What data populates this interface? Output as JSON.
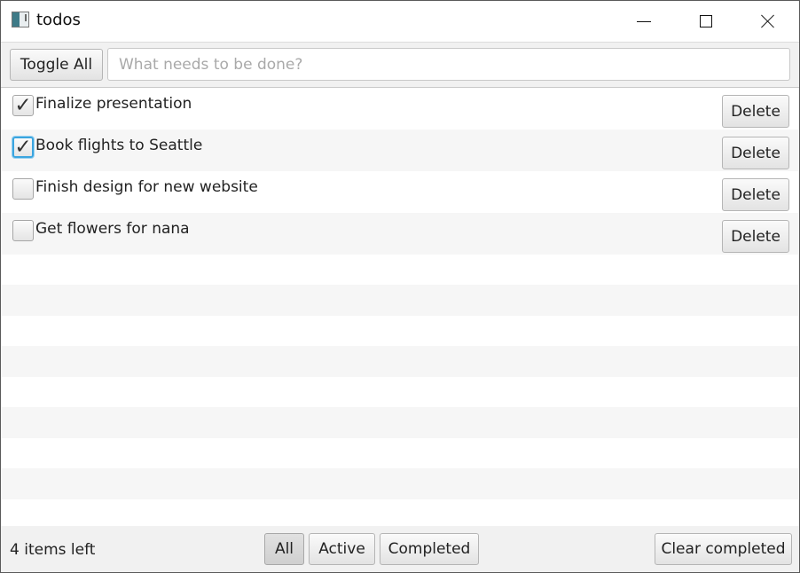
{
  "window": {
    "title": "todos",
    "controls": [
      "minimize-icon",
      "maximize-icon",
      "close-icon"
    ]
  },
  "toolbar": {
    "toggle_all_label": "Toggle All",
    "new_todo_placeholder": "What needs to be done?",
    "new_todo_value": ""
  },
  "todos": [
    {
      "label": "Finalize presentation",
      "checked": true,
      "check_glyph": "✓",
      "delete_label": "Delete"
    },
    {
      "label": "Book flights to Seattle",
      "checked": true,
      "check_glyph": "✓",
      "delete_label": "Delete"
    },
    {
      "label": "Finish design for new website",
      "checked": false,
      "check_glyph": "",
      "delete_label": "Delete"
    },
    {
      "label": "Get flowers for nana",
      "checked": false,
      "check_glyph": "",
      "delete_label": "Delete"
    }
  ],
  "footer": {
    "items_left": "4 items left",
    "filters": {
      "all": "All",
      "active": "Active",
      "completed": "Completed"
    },
    "selected_filter": "All",
    "clear_completed_label": "Clear completed"
  },
  "colors": {
    "focus_ring": "#3ba5df",
    "toolbar_background": "#f1f1f1",
    "striped_row": "#f6f6f6"
  }
}
